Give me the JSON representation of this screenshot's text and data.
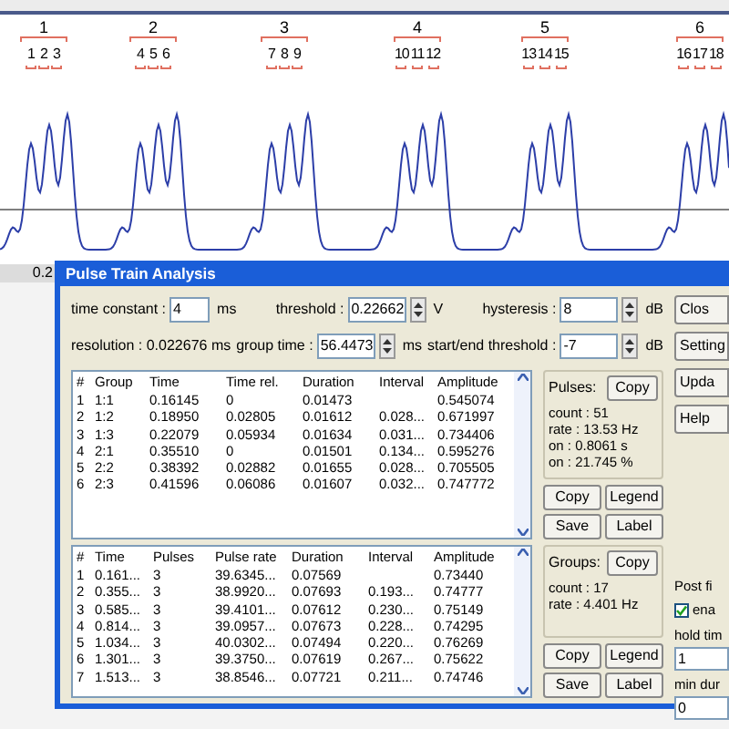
{
  "plot": {
    "axis_label": "0.2",
    "groups": [
      {
        "label": "1",
        "pulses": [
          "1",
          "2",
          "3"
        ]
      },
      {
        "label": "2",
        "pulses": [
          "4",
          "5",
          "6"
        ]
      },
      {
        "label": "3",
        "pulses": [
          "7",
          "8",
          "9"
        ]
      },
      {
        "label": "4",
        "pulses": [
          "10",
          "11",
          "12"
        ]
      },
      {
        "label": "5",
        "pulses": [
          "13",
          "14",
          "15"
        ]
      },
      {
        "label": "6",
        "pulses": [
          "16",
          "17",
          "18"
        ]
      }
    ]
  },
  "dialog": {
    "title": "Pulse Train Analysis",
    "rows": [
      [
        {
          "kind": "input",
          "label": "time constant :",
          "value": "4",
          "unit": "ms"
        },
        {
          "kind": "spin",
          "label": "threshold :",
          "value": "0.22662",
          "unit": "V"
        },
        {
          "kind": "spin",
          "label": "hysteresis :",
          "value": "8",
          "unit": "dB"
        }
      ],
      [
        {
          "kind": "text",
          "label": "resolution : 0.022676 ms"
        },
        {
          "kind": "spin",
          "label": "group time :",
          "value": "56.4473",
          "unit": "ms"
        },
        {
          "kind": "spin",
          "label": "start/end threshold :",
          "value": "-7",
          "unit": "dB"
        }
      ]
    ],
    "pulses_table": {
      "columns": [
        "#",
        "Group",
        "Time",
        "Time rel.",
        "Duration",
        "Interval",
        "Amplitude"
      ],
      "rows": [
        [
          "1",
          "1:1",
          "0.16145",
          "0",
          "0.01473",
          "",
          "0.545074"
        ],
        [
          "2",
          "1:2",
          "0.18950",
          "0.02805",
          "0.01612",
          "0.028...",
          "0.671997"
        ],
        [
          "3",
          "1:3",
          "0.22079",
          "0.05934",
          "0.01634",
          "0.031...",
          "0.734406"
        ],
        [
          "4",
          "2:1",
          "0.35510",
          "0",
          "0.01501",
          "0.134...",
          "0.595276"
        ],
        [
          "5",
          "2:2",
          "0.38392",
          "0.02882",
          "0.01655",
          "0.028...",
          "0.705505"
        ],
        [
          "6",
          "2:3",
          "0.41596",
          "0.06086",
          "0.01607",
          "0.032...",
          "0.747772"
        ]
      ]
    },
    "groups_table": {
      "columns": [
        "#",
        "Time",
        "Pulses",
        "Pulse rate",
        "Duration",
        "Interval",
        "Amplitude"
      ],
      "rows": [
        [
          "1",
          "0.161...",
          "3",
          "39.6345...",
          "0.07569",
          "",
          "0.73440"
        ],
        [
          "2",
          "0.355...",
          "3",
          "38.9920...",
          "0.07693",
          "0.193...",
          "0.74777"
        ],
        [
          "3",
          "0.585...",
          "3",
          "39.4101...",
          "0.07612",
          "0.230...",
          "0.75149"
        ],
        [
          "4",
          "0.814...",
          "3",
          "39.0957...",
          "0.07673",
          "0.228...",
          "0.74295"
        ],
        [
          "5",
          "1.034...",
          "3",
          "40.0302...",
          "0.07494",
          "0.220...",
          "0.76269"
        ],
        [
          "6",
          "1.301...",
          "3",
          "39.3750...",
          "0.07619",
          "0.267...",
          "0.75622"
        ],
        [
          "7",
          "1.513...",
          "3",
          "38.8546...",
          "0.07721",
          "0.211...",
          "0.74746"
        ]
      ]
    },
    "pulses_panel": {
      "title": "Pulses:",
      "copy": "Copy",
      "stats": [
        "count : 51",
        "rate : 13.53 Hz",
        "on : 0.8061 s",
        "on : 21.745 %"
      ],
      "buttons": [
        "Copy",
        "Legend",
        "Save",
        "Label"
      ]
    },
    "groups_panel": {
      "title": "Groups:",
      "copy": "Copy",
      "stats": [
        "count : 17",
        "rate : 4.401 Hz"
      ],
      "buttons": [
        "Copy",
        "Legend",
        "Save",
        "Label"
      ]
    },
    "side_buttons": [
      "Clos",
      "Setting",
      "Upda",
      "Help"
    ],
    "post_filter": {
      "title": "Post fi",
      "checkbox": {
        "label": "ena",
        "checked": true
      },
      "fields": [
        {
          "label": "hold tim",
          "value": "1"
        },
        {
          "label": "min dur",
          "value": "0"
        }
      ]
    }
  }
}
